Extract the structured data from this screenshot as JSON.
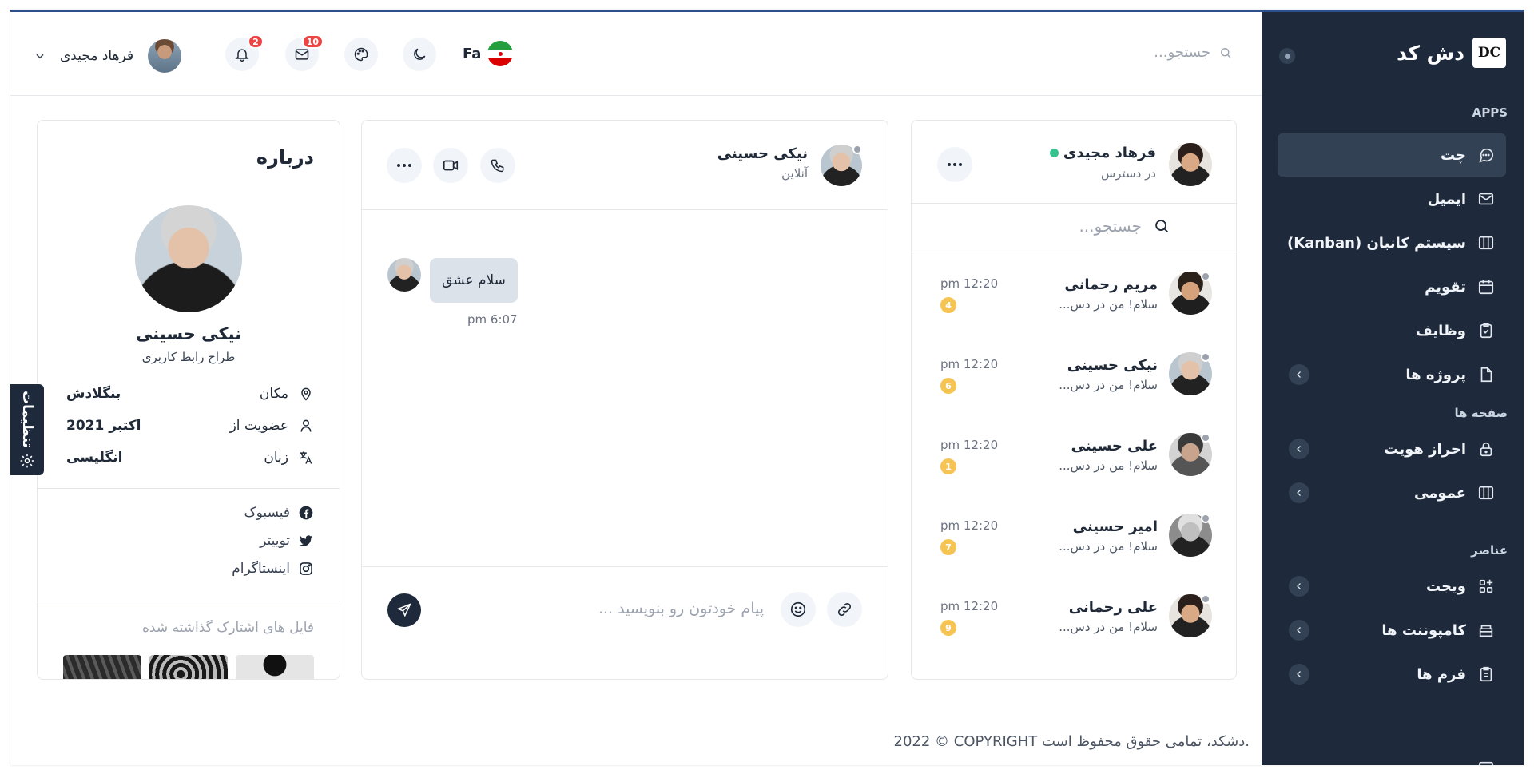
{
  "brand": {
    "name": "دش کد",
    "logo": "DC"
  },
  "sidebar": {
    "section_apps": "APPS",
    "section_pages": "صفحه ها",
    "section_elements": "عناصر",
    "items": [
      {
        "label": "چت",
        "icon": "chat-icon",
        "active": true
      },
      {
        "label": "ایمیل",
        "icon": "mail-icon"
      },
      {
        "label": "سیستم کانبان (Kanban)",
        "icon": "kanban-icon"
      },
      {
        "label": "تقویم",
        "icon": "calendar-icon"
      },
      {
        "label": "وظایف",
        "icon": "clipboard-check-icon"
      },
      {
        "label": "پروژه ها",
        "icon": "file-icon",
        "has_children": true
      },
      {
        "label": "احراز هویت",
        "icon": "lock-icon",
        "has_children": true
      },
      {
        "label": "عمومی",
        "icon": "columns-icon",
        "has_children": true
      },
      {
        "label": "ویجت",
        "icon": "widgets-icon",
        "has_children": true
      },
      {
        "label": "کامپوننت ها",
        "icon": "box-icon",
        "has_children": true
      },
      {
        "label": "فرم ها",
        "icon": "form-icon",
        "has_children": true
      }
    ]
  },
  "header": {
    "search_placeholder": "جستجو...",
    "language": "Fa",
    "mail_count": "10",
    "notification_count": "2",
    "user_name": "فرهاد مجیدی"
  },
  "contacts": {
    "me": {
      "name": "فرهاد مجیدی",
      "status": "در دسترس"
    },
    "search_placeholder": "جستجو...",
    "list": [
      {
        "name": "مریم رحمانی",
        "message": "سلام! من در دس...",
        "time": "pm 12:20",
        "count": "4"
      },
      {
        "name": "نیکی حسینی",
        "message": "سلام! من در دس...",
        "time": "pm 12:20",
        "count": "6"
      },
      {
        "name": "علی حسینی",
        "message": "سلام! من در دس...",
        "time": "pm 12:20",
        "count": "1"
      },
      {
        "name": "امیر حسینی",
        "message": "سلام! من در دس...",
        "time": "pm 12:20",
        "count": "7"
      },
      {
        "name": "علی رحمانی",
        "message": "سلام! من در دس...",
        "time": "pm 12:20",
        "count": "9"
      }
    ]
  },
  "chat": {
    "name": "نیکی حسینی",
    "status": "آنلاین",
    "messages": [
      {
        "text": "سلام عشق",
        "time": "pm 6:07"
      }
    ],
    "input_placeholder": "پیام خودتون رو بنویسید ..."
  },
  "about": {
    "title": "درباره",
    "name": "نیکی حسینی",
    "role": "طراح رابط کاربری",
    "rows": [
      {
        "label": "مکان",
        "value": "بنگلادش",
        "icon": "location-icon"
      },
      {
        "label": "عضویت از",
        "value": "اکتبر 2021",
        "icon": "user-icon"
      },
      {
        "label": "زبان",
        "value": "انگلیسی",
        "icon": "translate-icon"
      }
    ],
    "socials": [
      {
        "label": "فیسبوک",
        "icon": "facebook-icon"
      },
      {
        "label": "توییتر",
        "icon": "twitter-icon"
      },
      {
        "label": "اینستاگرام",
        "icon": "instagram-icon"
      }
    ],
    "shared_files_title": "فایل های اشتارک گذاشته شده"
  },
  "settings_tab": "تنظیمات",
  "footer": "2022 © COPYRIGHT دشکد، تمامی حقوق محفوظ است.",
  "colors": {
    "sidebar_bg": "#1e293b",
    "accent_top": "#2d4f8c",
    "online": "#34c38f",
    "count_badge": "#f6c453",
    "notification_badge": "#ef4444"
  }
}
